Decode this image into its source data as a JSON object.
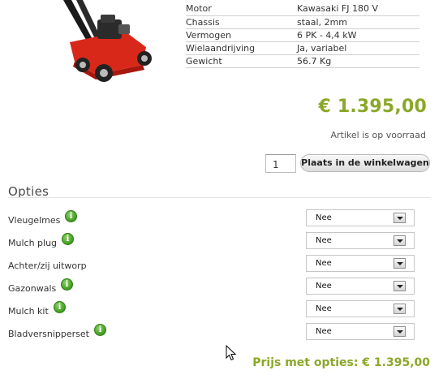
{
  "specs": [
    {
      "label": "Motor",
      "value": "Kawasaki FJ 180 V"
    },
    {
      "label": "Chassis",
      "value": "staal, 2mm"
    },
    {
      "label": "Vermogen",
      "value": "6 PK - 4,4 kW"
    },
    {
      "label": "Wielaandrijving",
      "value": "Ja, variabel"
    },
    {
      "label": "Gewicht",
      "value": "56.7 Kg"
    }
  ],
  "price": "€ 1.395,00",
  "stock_status": "Artikel is op voorraad",
  "quantity": "1",
  "add_to_cart_label": "Plaats in de winkelwagen",
  "options_title": "Opties",
  "options": [
    {
      "label": "Vleugelmes",
      "info": true,
      "selected": "Nee"
    },
    {
      "label": "Mulch plug",
      "info": true,
      "selected": "Nee"
    },
    {
      "label": "Achter/zij uitworp",
      "info": false,
      "selected": "Nee"
    },
    {
      "label": "Gazonwals",
      "info": true,
      "selected": "Nee"
    },
    {
      "label": "Mulch kit",
      "info": true,
      "selected": "Nee"
    },
    {
      "label": "Bladversnipperset",
      "info": true,
      "selected": "Nee"
    }
  ],
  "total_price": "Prijs met opties: € 1.395,00",
  "colors": {
    "price_green": "#8aa828",
    "mower_red": "#d8281a"
  },
  "icons": {
    "info": "info-icon",
    "dropdown": "chevron-down-icon",
    "cursor": "mouse-pointer-icon"
  }
}
